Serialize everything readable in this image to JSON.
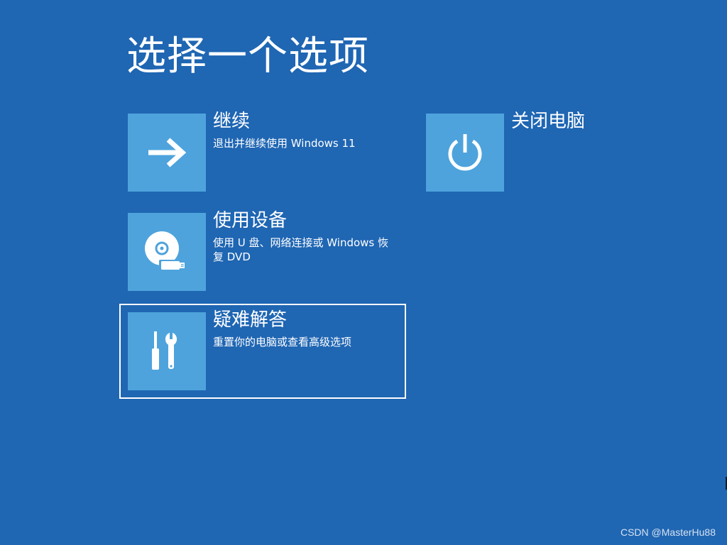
{
  "page": {
    "title": "选择一个选项"
  },
  "options": [
    {
      "id": "continue",
      "label": "继续",
      "description": "退出并继续使用 Windows 11",
      "icon": "arrow-right-icon"
    },
    {
      "id": "use_device",
      "label": "使用设备",
      "description": "使用 U 盘、网络连接或 Windows 恢复 DVD",
      "icon": "disc-usb-icon"
    },
    {
      "id": "troubleshoot",
      "label": "疑难解答",
      "description": "重置你的电脑或查看高级选项",
      "icon": "tools-icon",
      "focused": true
    },
    {
      "id": "shutdown",
      "label": "关闭电脑",
      "description": "",
      "icon": "power-icon"
    }
  ],
  "colors": {
    "background": "#1f66b3",
    "tile": "#4ea3dc",
    "text": "#ffffff"
  },
  "watermark": "CSDN @MasterHu88"
}
